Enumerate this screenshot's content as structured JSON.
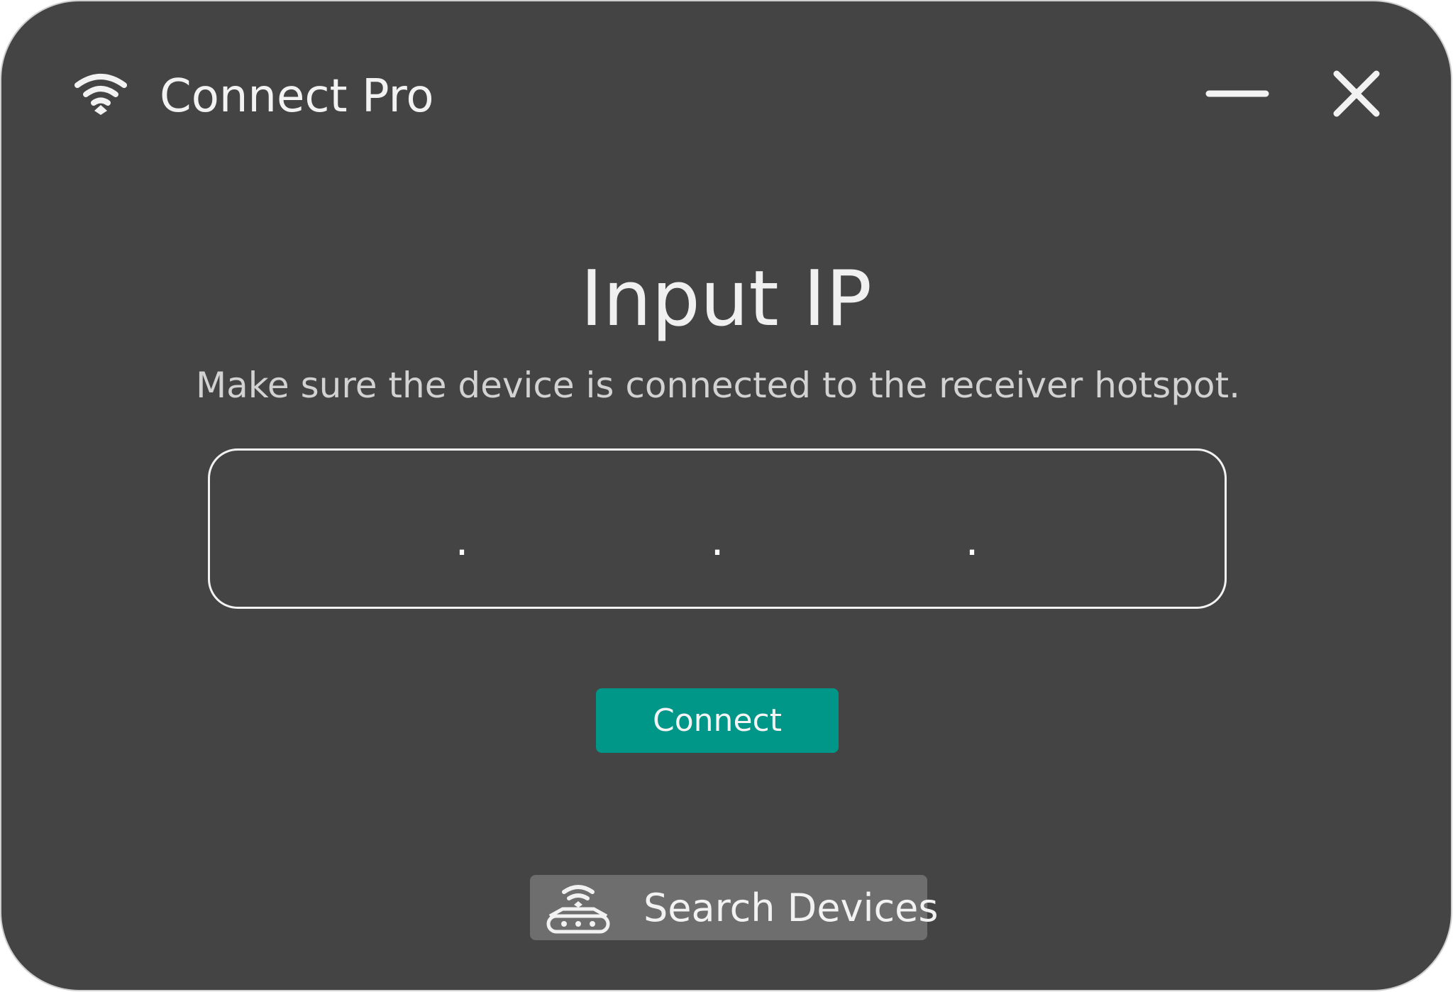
{
  "app": {
    "title": "Connect Pro",
    "icon": "wifi-icon"
  },
  "window_controls": {
    "minimize_icon": "minimize-icon",
    "close_icon": "close-icon"
  },
  "main": {
    "title": "Input IP",
    "subtitle": "Make sure the device is connected to the receiver hotspot.",
    "ip_input": {
      "segments": [
        "",
        "",
        "",
        ""
      ],
      "separator": "."
    },
    "connect_button": {
      "label": "Connect",
      "color": "#009688"
    }
  },
  "footer": {
    "search_button": {
      "label": "Search Devices",
      "icon": "router-icon"
    }
  },
  "colors": {
    "window_bg": "#444444",
    "accent": "#009688",
    "secondary_button": "#6e6e6e"
  }
}
